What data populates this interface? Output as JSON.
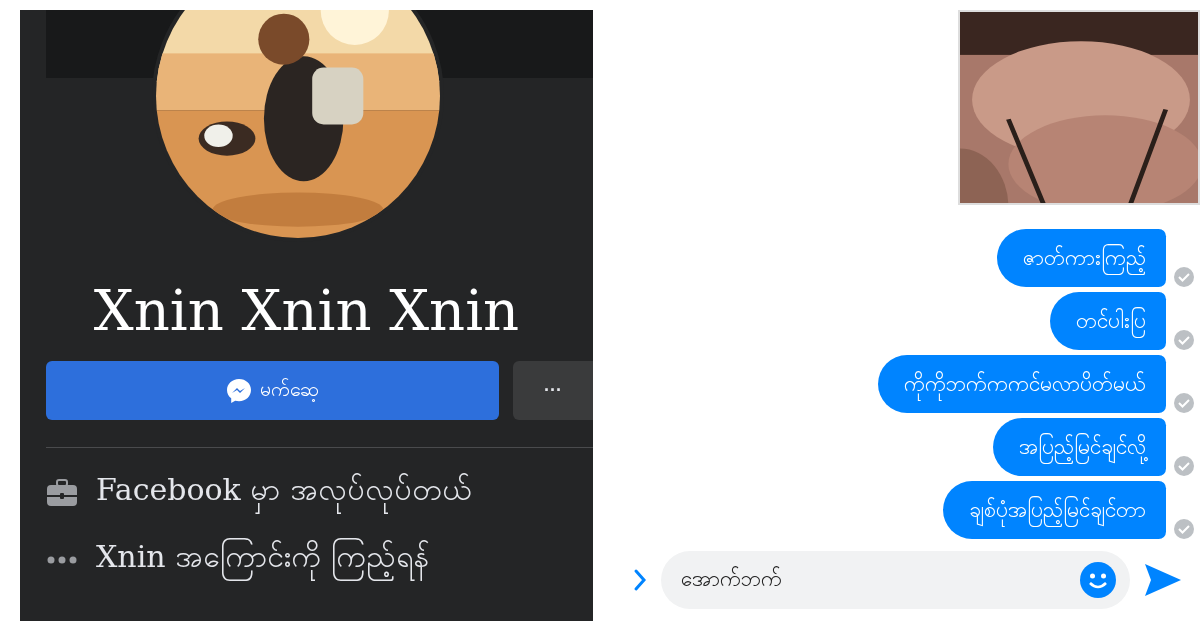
{
  "profile": {
    "name": "Xnin Xnin Xnin",
    "message_button": "မက်ဆေ့",
    "more_button": "···",
    "details": [
      {
        "kind": "work",
        "text": "Facebook မှာ အလုပ်လုပ်တယ်"
      },
      {
        "kind": "more",
        "text": "Xnin အကြောင်းကို ကြည့်ရန်"
      }
    ]
  },
  "chat": {
    "messages": [
      {
        "text": "ဇာတ်ကားကြည့်",
        "seen": true
      },
      {
        "text": "တင်ပါးပြ",
        "seen": true
      },
      {
        "text": "ကိုကိုဘက်ကကင်မလာပိတ်မယ်",
        "seen": true
      },
      {
        "text": "အပြည့်မြင်ချင်လို့",
        "seen": true
      },
      {
        "text": "ချစ်ပုံအပြည့်မြင်ချင်တာ",
        "seen": true
      }
    ],
    "composer": {
      "value": "အောက်ဘက်"
    }
  }
}
